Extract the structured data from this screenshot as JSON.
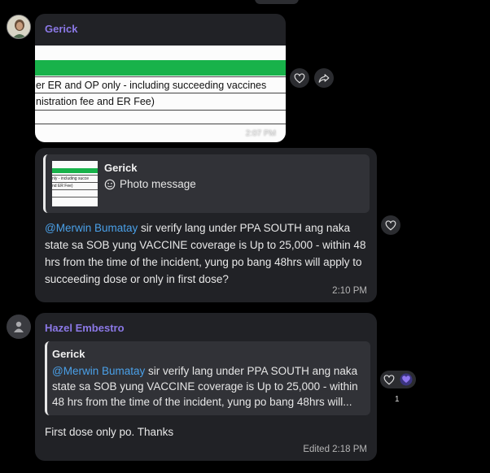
{
  "messages": [
    {
      "sender": "Gerick",
      "photo": {
        "line1": "er ER and OP only - including succeeding vaccines",
        "line2": "nistration fee and ER Fee)",
        "time": "2:07 PM"
      }
    },
    {
      "reply_to": {
        "name": "Gerick",
        "label": "Photo message"
      },
      "mention": "@Merwin Bumatay",
      "body": " sir verify lang under PPA SOUTH ang naka state sa SOB yung VACCINE coverage is Up to 25,000 - within 48 hrs from the time of the incident, yung po bang 48hrs will apply to succeeding dose or only in first dose?",
      "time": "2:10 PM"
    },
    {
      "sender": "Hazel Embestro",
      "quote": {
        "name": "Gerick",
        "mention": "@Merwin Bumatay",
        "body": " sir verify lang under PPA SOUTH ang naka state sa SOB yung VACCINE coverage is Up to 25,000 - within 48 hrs from the time of the incident, yung po bang 48hrs will..."
      },
      "body": "First dose only po. Thanks",
      "time": "Edited 2:18 PM",
      "reaction_count": "1"
    }
  ],
  "thumb_text": {
    "line1": "nly - including succe",
    "line2": "nd ER Fee)"
  },
  "colors": {
    "sender": "#8b78e6",
    "mention": "#4aa0e8",
    "green_bar": "#18b24a",
    "reaction_heart": "#7b5fe8"
  },
  "icons": [
    "heart-icon",
    "share-icon",
    "person-icon",
    "photo-icon"
  ]
}
